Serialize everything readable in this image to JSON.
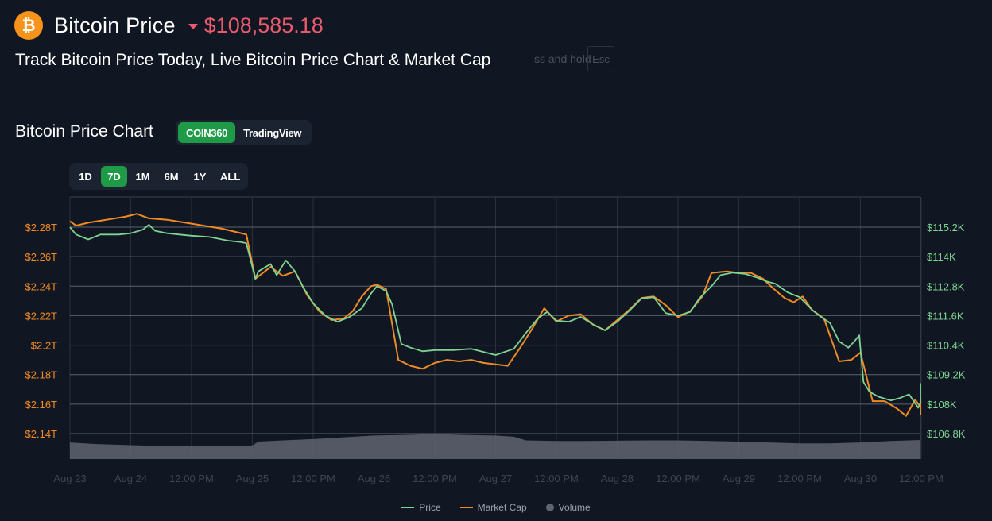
{
  "header": {
    "logo_symbol": "₿",
    "logo_icon": "bitcoin-logo-icon",
    "title": "Bitcoin Price",
    "trend_icon": "caret-down-icon",
    "price": "$108,585.18",
    "price_color": "#ea5b6e"
  },
  "subtitle": "Track Bitcoin Price Today, Live Bitcoin Price Chart & Market Cap",
  "overlay": {
    "hint": "ss and hold",
    "key": "Esc"
  },
  "chart_section": {
    "title": "Bitcoin Price Chart",
    "sources": [
      {
        "label": "COIN360",
        "active": true
      },
      {
        "label": "TradingView",
        "active": false
      }
    ],
    "ranges": [
      {
        "label": "1D",
        "active": false
      },
      {
        "label": "7D",
        "active": true
      },
      {
        "label": "1M",
        "active": false
      },
      {
        "label": "6M",
        "active": false
      },
      {
        "label": "1Y",
        "active": false
      },
      {
        "label": "ALL",
        "active": false
      }
    ]
  },
  "chart_data": {
    "type": "line",
    "x_ticks": [
      "Aug 23",
      "Aug 24",
      "12:00 PM",
      "Aug 25",
      "12:00 PM",
      "Aug 26",
      "12:00 PM",
      "Aug 27",
      "12:00 PM",
      "Aug 28",
      "12:00 PM",
      "Aug 29",
      "12:00 PM",
      "Aug 30",
      "12:00 PM"
    ],
    "x_range": [
      0,
      14
    ],
    "left_axis": {
      "ticks": [
        "$2.28T",
        "$2.26T",
        "$2.24T",
        "$2.22T",
        "$2.2T",
        "$2.18T",
        "$2.16T",
        "$2.14T"
      ],
      "tick_values": [
        2.28,
        2.26,
        2.24,
        2.22,
        2.2,
        2.18,
        2.16,
        2.14
      ],
      "range": [
        2.14,
        2.28
      ],
      "color": "#f08a24"
    },
    "right_axis": {
      "ticks": [
        "$115.2K",
        "$114K",
        "$112.8K",
        "$111.6K",
        "$110.4K",
        "$109.2K",
        "$108K",
        "$106.8K"
      ],
      "tick_values": [
        115.2,
        114,
        112.8,
        111.6,
        110.4,
        109.2,
        108,
        106.8
      ],
      "range": [
        106.8,
        115.2
      ],
      "color": "#7ed492"
    },
    "grid": true,
    "legend_position": "bottom-center",
    "series": [
      {
        "name": "Price",
        "axis": "right",
        "color": "#7ed492",
        "points": [
          [
            0,
            115.2
          ],
          [
            0.1,
            114.9
          ],
          [
            0.3,
            114.7
          ],
          [
            0.5,
            114.9
          ],
          [
            0.8,
            114.9
          ],
          [
            1.0,
            114.95
          ],
          [
            1.2,
            115.1
          ],
          [
            1.3,
            115.3
          ],
          [
            1.4,
            115.05
          ],
          [
            1.6,
            114.95
          ],
          [
            1.8,
            114.9
          ],
          [
            2.0,
            114.85
          ],
          [
            2.3,
            114.8
          ],
          [
            2.6,
            114.65
          ],
          [
            2.8,
            114.6
          ],
          [
            2.9,
            114.55
          ],
          [
            3.05,
            113.1
          ],
          [
            3.1,
            113.4
          ],
          [
            3.3,
            113.7
          ],
          [
            3.4,
            113.25
          ],
          [
            3.55,
            113.85
          ],
          [
            3.7,
            113.4
          ],
          [
            3.85,
            112.7
          ],
          [
            4.0,
            112.1
          ],
          [
            4.2,
            111.6
          ],
          [
            4.4,
            111.35
          ],
          [
            4.6,
            111.55
          ],
          [
            4.8,
            111.9
          ],
          [
            4.95,
            112.5
          ],
          [
            5.05,
            112.8
          ],
          [
            5.2,
            112.6
          ],
          [
            5.3,
            112.05
          ],
          [
            5.45,
            110.45
          ],
          [
            5.6,
            110.3
          ],
          [
            5.8,
            110.15
          ],
          [
            6.0,
            110.2
          ],
          [
            6.3,
            110.2
          ],
          [
            6.6,
            110.25
          ],
          [
            7.0,
            110.0
          ],
          [
            7.3,
            110.25
          ],
          [
            7.5,
            110.9
          ],
          [
            7.7,
            111.5
          ],
          [
            7.85,
            111.75
          ],
          [
            8.0,
            111.4
          ],
          [
            8.2,
            111.35
          ],
          [
            8.4,
            111.55
          ],
          [
            8.6,
            111.25
          ],
          [
            8.8,
            111.0
          ],
          [
            9.0,
            111.35
          ],
          [
            9.2,
            111.8
          ],
          [
            9.4,
            112.3
          ],
          [
            9.6,
            112.35
          ],
          [
            9.8,
            111.7
          ],
          [
            10.0,
            111.6
          ],
          [
            10.2,
            111.75
          ],
          [
            10.35,
            112.3
          ],
          [
            10.55,
            112.8
          ],
          [
            10.7,
            113.25
          ],
          [
            10.9,
            113.35
          ],
          [
            11.1,
            113.3
          ],
          [
            11.3,
            113.15
          ],
          [
            11.45,
            113.0
          ],
          [
            11.6,
            112.9
          ],
          [
            11.8,
            112.55
          ],
          [
            12.0,
            112.35
          ],
          [
            12.2,
            111.85
          ],
          [
            12.35,
            111.55
          ],
          [
            12.5,
            111.3
          ],
          [
            12.65,
            110.55
          ],
          [
            12.8,
            110.3
          ],
          [
            12.9,
            110.55
          ],
          [
            12.98,
            110.8
          ],
          [
            13.05,
            108.9
          ],
          [
            13.15,
            108.5
          ],
          [
            13.3,
            108.3
          ],
          [
            13.5,
            108.15
          ],
          [
            13.65,
            108.25
          ],
          [
            13.8,
            108.4
          ],
          [
            13.95,
            107.85
          ],
          [
            14.1,
            108.05
          ],
          [
            14.3,
            108.05
          ],
          [
            14.5,
            108.15
          ],
          [
            14.7,
            108.45
          ],
          [
            14.9,
            108.5
          ],
          [
            15.1,
            108.65
          ],
          [
            15.3,
            108.75
          ],
          [
            15.5,
            108.85
          ],
          [
            15.55,
            108.85
          ]
        ]
      },
      {
        "name": "Market Cap",
        "axis": "left",
        "color": "#f08a24",
        "points": [
          [
            0,
            2.284
          ],
          [
            0.1,
            2.281
          ],
          [
            0.3,
            2.283
          ],
          [
            0.6,
            2.285
          ],
          [
            0.9,
            2.287
          ],
          [
            1.1,
            2.289
          ],
          [
            1.3,
            2.286
          ],
          [
            1.6,
            2.285
          ],
          [
            1.9,
            2.283
          ],
          [
            2.2,
            2.281
          ],
          [
            2.5,
            2.279
          ],
          [
            2.8,
            2.276
          ],
          [
            2.9,
            2.275
          ],
          [
            3.05,
            2.245
          ],
          [
            3.3,
            2.253
          ],
          [
            3.5,
            2.247
          ],
          [
            3.7,
            2.25
          ],
          [
            3.9,
            2.234
          ],
          [
            4.1,
            2.223
          ],
          [
            4.3,
            2.217
          ],
          [
            4.5,
            2.218
          ],
          [
            4.65,
            2.223
          ],
          [
            4.8,
            2.233
          ],
          [
            4.95,
            2.24
          ],
          [
            5.05,
            2.241
          ],
          [
            5.2,
            2.238
          ],
          [
            5.4,
            2.19
          ],
          [
            5.6,
            2.186
          ],
          [
            5.8,
            2.184
          ],
          [
            6.0,
            2.188
          ],
          [
            6.2,
            2.19
          ],
          [
            6.4,
            2.189
          ],
          [
            6.6,
            2.19
          ],
          [
            6.8,
            2.188
          ],
          [
            7.0,
            2.187
          ],
          [
            7.2,
            2.186
          ],
          [
            7.4,
            2.198
          ],
          [
            7.6,
            2.211
          ],
          [
            7.8,
            2.225
          ],
          [
            8.0,
            2.216
          ],
          [
            8.2,
            2.22
          ],
          [
            8.4,
            2.221
          ],
          [
            8.6,
            2.214
          ],
          [
            8.8,
            2.21
          ],
          [
            9.0,
            2.217
          ],
          [
            9.2,
            2.224
          ],
          [
            9.4,
            2.232
          ],
          [
            9.6,
            2.233
          ],
          [
            9.8,
            2.227
          ],
          [
            10.0,
            2.219
          ],
          [
            10.2,
            2.223
          ],
          [
            10.4,
            2.233
          ],
          [
            10.55,
            2.249
          ],
          [
            10.8,
            2.25
          ],
          [
            11.0,
            2.249
          ],
          [
            11.2,
            2.249
          ],
          [
            11.4,
            2.245
          ],
          [
            11.55,
            2.239
          ],
          [
            11.75,
            2.232
          ],
          [
            11.9,
            2.229
          ],
          [
            12.05,
            2.233
          ],
          [
            12.2,
            2.224
          ],
          [
            12.4,
            2.218
          ],
          [
            12.65,
            2.189
          ],
          [
            12.85,
            2.19
          ],
          [
            13.0,
            2.195
          ],
          [
            13.2,
            2.162
          ],
          [
            13.4,
            2.162
          ],
          [
            13.6,
            2.157
          ],
          [
            13.75,
            2.152
          ],
          [
            13.9,
            2.163
          ],
          [
            14.1,
            2.158
          ],
          [
            14.3,
            2.153
          ],
          [
            14.45,
            2.163
          ],
          [
            14.6,
            2.159
          ],
          [
            14.8,
            2.161
          ],
          [
            15.0,
            2.163
          ],
          [
            15.2,
            2.164
          ],
          [
            15.55,
            2.164
          ]
        ]
      },
      {
        "name": "Volume",
        "type": "area",
        "color": "#5f6470",
        "relative_levels": [
          [
            0,
            0.55
          ],
          [
            0.4,
            0.5
          ],
          [
            1.0,
            0.46
          ],
          [
            1.5,
            0.43
          ],
          [
            2.0,
            0.43
          ],
          [
            2.5,
            0.44
          ],
          [
            3.0,
            0.45
          ],
          [
            3.1,
            0.58
          ],
          [
            3.5,
            0.62
          ],
          [
            4.0,
            0.66
          ],
          [
            4.5,
            0.72
          ],
          [
            5.0,
            0.78
          ],
          [
            5.5,
            0.8
          ],
          [
            6.0,
            0.83
          ],
          [
            6.5,
            0.8
          ],
          [
            7.0,
            0.78
          ],
          [
            7.3,
            0.74
          ],
          [
            7.5,
            0.62
          ],
          [
            8.0,
            0.6
          ],
          [
            8.5,
            0.6
          ],
          [
            9.0,
            0.61
          ],
          [
            9.5,
            0.62
          ],
          [
            10.0,
            0.62
          ],
          [
            10.5,
            0.6
          ],
          [
            11.0,
            0.58
          ],
          [
            11.5,
            0.55
          ],
          [
            12.0,
            0.52
          ],
          [
            12.5,
            0.52
          ],
          [
            13.0,
            0.55
          ],
          [
            13.5,
            0.6
          ],
          [
            14.0,
            0.63
          ],
          [
            14.5,
            0.62
          ],
          [
            15.0,
            0.6
          ],
          [
            15.55,
            0.58
          ]
        ]
      }
    ]
  },
  "legend": [
    {
      "label": "Price",
      "color": "#7ed492",
      "kind": "line"
    },
    {
      "label": "Market Cap",
      "color": "#f08a24",
      "kind": "line"
    },
    {
      "label": "Volume",
      "color": "#5f6470",
      "kind": "dot"
    }
  ]
}
